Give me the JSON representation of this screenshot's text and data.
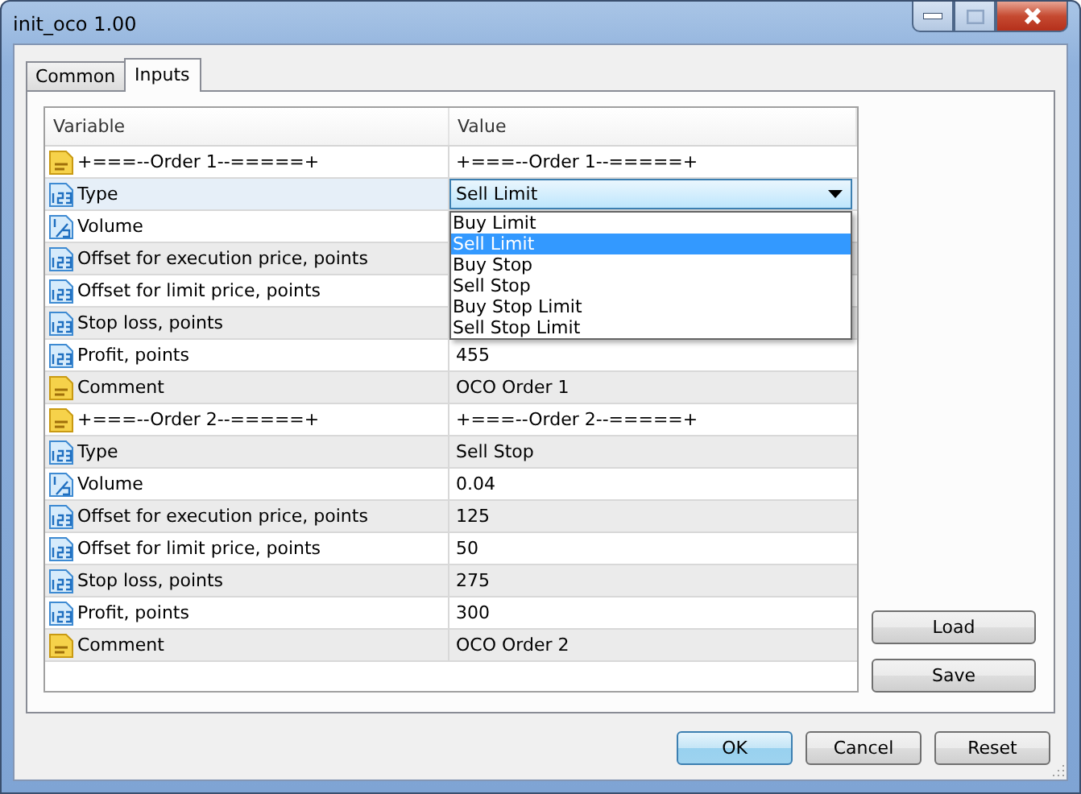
{
  "window": {
    "title": "init_oco 1.00"
  },
  "tabs": [
    {
      "label": "Common",
      "selected": false
    },
    {
      "label": "Inputs",
      "selected": true
    }
  ],
  "table": {
    "columns": [
      "Variable",
      "Value"
    ],
    "rows": [
      {
        "kind": "text",
        "variable": "+===--Order 1--=====+",
        "value": "+===--Order 1--=====+",
        "selected": false
      },
      {
        "kind": "int",
        "variable": "Type",
        "value": "Sell Limit",
        "selected": true,
        "dropdown": {
          "expanded": true,
          "options": [
            {
              "label": "Buy Limit",
              "selected": false
            },
            {
              "label": "Sell Limit",
              "selected": true
            },
            {
              "label": "Buy Stop",
              "selected": false
            },
            {
              "label": "Sell Stop",
              "selected": false
            },
            {
              "label": "Buy Stop Limit",
              "selected": false
            },
            {
              "label": "Sell Stop Limit",
              "selected": false
            }
          ]
        }
      },
      {
        "kind": "double",
        "variable": "Volume",
        "selected": false
      },
      {
        "kind": "int",
        "variable": "Offset for execution price, points",
        "selected": false
      },
      {
        "kind": "int",
        "variable": "Offset for limit price, points",
        "selected": false
      },
      {
        "kind": "int",
        "variable": "Stop loss, points",
        "selected": false
      },
      {
        "kind": "int",
        "variable": "Profit, points",
        "value": "455",
        "selected": false
      },
      {
        "kind": "text",
        "variable": "Comment",
        "value": "OCO Order 1",
        "selected": false
      },
      {
        "kind": "text",
        "variable": "+===--Order 2--=====+",
        "value": "+===--Order 2--=====+",
        "selected": false
      },
      {
        "kind": "int",
        "variable": "Type",
        "value": "Sell Stop",
        "selected": false
      },
      {
        "kind": "double",
        "variable": "Volume",
        "value": "0.04",
        "selected": false
      },
      {
        "kind": "int",
        "variable": "Offset for execution price, points",
        "value": "125",
        "selected": false
      },
      {
        "kind": "int",
        "variable": "Offset for limit price, points",
        "value": "50",
        "selected": false
      },
      {
        "kind": "int",
        "variable": "Stop loss, points",
        "value": "275",
        "selected": false
      },
      {
        "kind": "int",
        "variable": "Profit, points",
        "value": "300",
        "selected": false
      },
      {
        "kind": "text",
        "variable": "Comment",
        "value": "OCO Order 2",
        "selected": false
      }
    ]
  },
  "side_buttons": [
    "Load",
    "Save"
  ],
  "buttons": [
    {
      "label": "OK",
      "default": true
    },
    {
      "label": "Cancel",
      "default": false
    },
    {
      "label": "Reset",
      "default": false
    }
  ]
}
